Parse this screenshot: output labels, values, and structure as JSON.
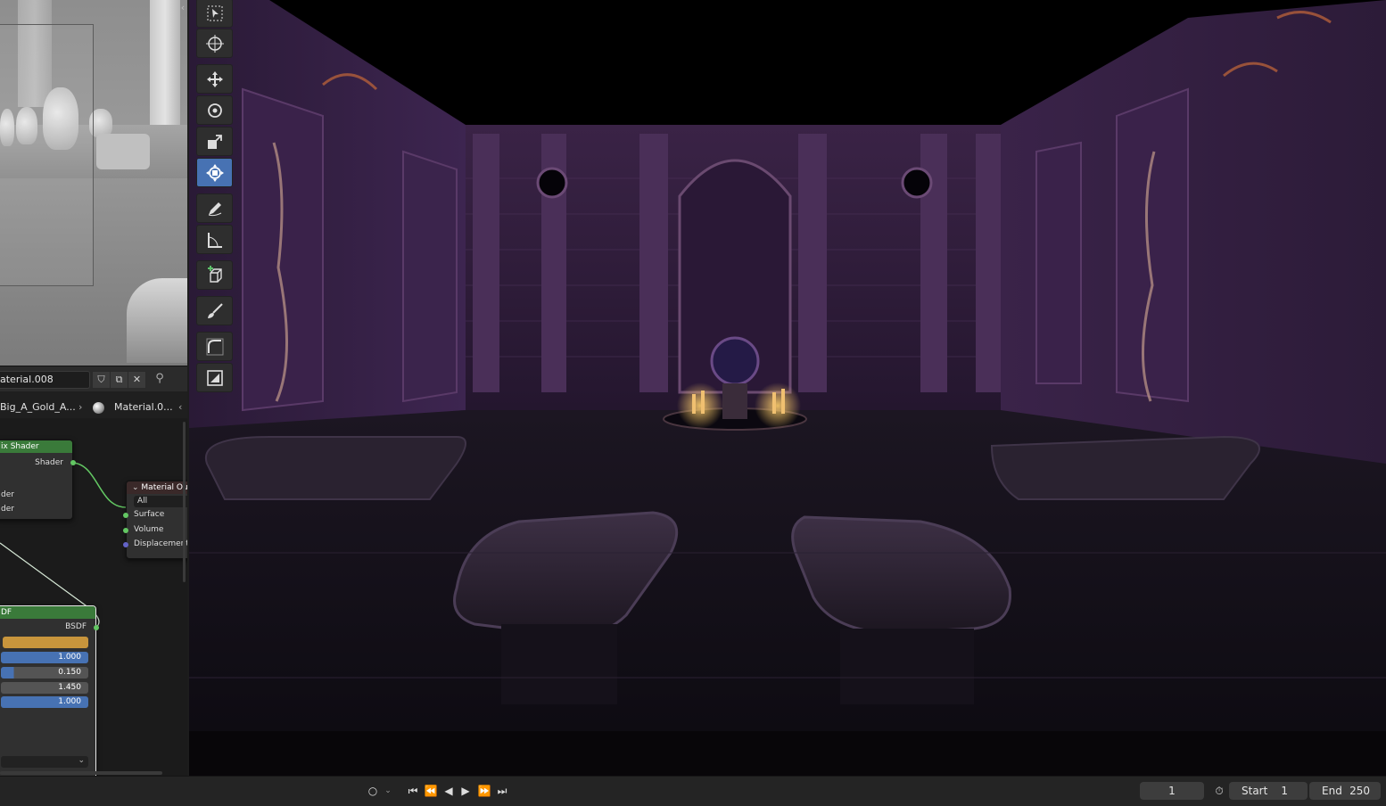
{
  "node_editor": {
    "material_name": "aterial.008",
    "breadcrumb_object": "Big_A_Gold_A...",
    "breadcrumb_material": "Material.0...",
    "mix_shader_node": {
      "title": "ix Shader",
      "output_label": "Shader",
      "input_1": "der",
      "input_2": "der"
    },
    "material_output_node": {
      "title": "Material Outp",
      "target": "All",
      "inputs": [
        "Surface",
        "Volume",
        "Displacement"
      ]
    },
    "bsdf_node": {
      "title": "DF",
      "output_label": "BSDF",
      "base_color": "#c8953c",
      "values": [
        "1.000",
        "0.150",
        "1.450",
        "1.000"
      ],
      "value_fill_fractions": [
        1.0,
        0.15,
        0.0,
        1.0
      ]
    }
  },
  "toolbar": {
    "tools": [
      "select-box",
      "cursor",
      "move",
      "rotate",
      "scale",
      "transform",
      "annotate",
      "measure",
      "add-cube",
      "brush",
      "curve",
      "shading"
    ],
    "active_tool": "transform"
  },
  "timeline": {
    "current_frame": "1",
    "start_label": "Start",
    "start_value": "1",
    "end_label": "End",
    "end_value": "250"
  },
  "colors": {
    "accent_blue": "#4772b3",
    "shader_green": "#63c763",
    "node_header_green": "#3a7a3a"
  }
}
